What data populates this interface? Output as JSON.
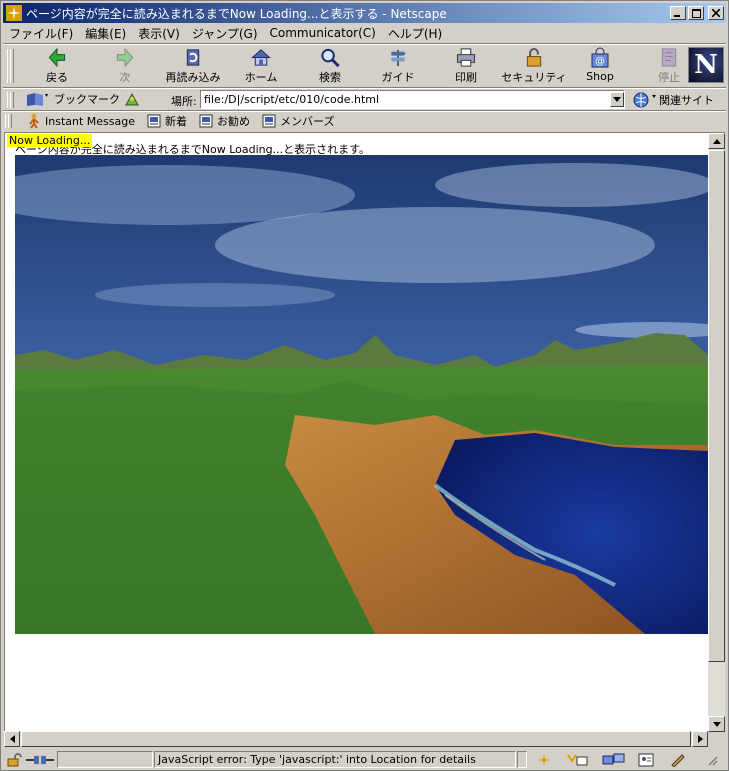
{
  "window": {
    "title": "ページ内容が完全に読み込まれるまでNow Loading...と表示する - Netscape"
  },
  "menu": [
    "ファイル(F)",
    "編集(E)",
    "表示(V)",
    "ジャンプ(G)",
    "Communicator(C)",
    "ヘルプ(H)"
  ],
  "nav": {
    "back": "戻る",
    "forward": "次",
    "reload": "再読み込み",
    "home": "ホーム",
    "search": "検索",
    "guide": "ガイド",
    "print": "印刷",
    "security": "セキュリティ",
    "shop": "Shop",
    "stop": "停止"
  },
  "location": {
    "bookmarks": "ブックマーク",
    "label": "場所:",
    "url": "file:/D|/script/etc/010/code.html",
    "related": "関連サイト"
  },
  "personal": {
    "instant_message": "Instant Message",
    "new": "新着",
    "recommend": "お勧め",
    "members": "メンバーズ"
  },
  "page": {
    "loading_label": "Now Loading...",
    "message": "ページ内容が完全に読み込まれるまでNow Loading...と表示されます。"
  },
  "status": {
    "text": "JavaScript error: Type 'javascript:' into Location for details"
  }
}
